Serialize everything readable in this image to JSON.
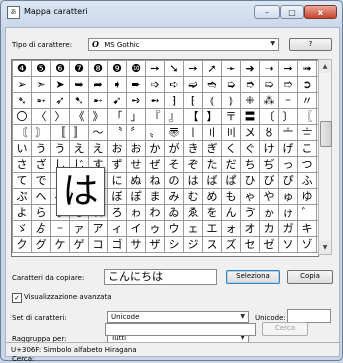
{
  "window": {
    "title": "Mappa caratteri",
    "minimize_symbol": "–",
    "maximize_symbol": "□",
    "close_symbol": "x"
  },
  "font_row": {
    "label": "Tipo di carattere:",
    "value": "MS Gothic",
    "font_glyph": "O",
    "help_label": "?"
  },
  "grid": {
    "rows": [
      [
        "❹",
        "❺",
        "❻",
        "❼",
        "❽",
        "❾",
        "❿",
        "➙",
        "➘",
        "➙",
        "➚",
        "➛",
        "➜",
        "➝",
        "➞",
        "➟",
        "➠"
      ],
      [
        "➢",
        "➣",
        "➤",
        "➥",
        "➦",
        "➧",
        "➨",
        "➩",
        "➪",
        "➫",
        "➬",
        "➭",
        "➮",
        "➯",
        "➱",
        "➲",
        "➳"
      ],
      [
        "➴",
        "➵",
        "➶",
        "➷",
        "➸",
        "➹",
        "➺",
        "➻",
        "⁆",
        "⁅",
        "⦅",
        "⦆",
        "⁜",
        "⁂",
        "゠",
        "〃",
        "〄"
      ],
      [
        "〇",
        "〈",
        "〉",
        "《",
        "》",
        "「",
        "」",
        "『",
        "』",
        "【",
        "】",
        "〒",
        "〓",
        "〔",
        "〕",
        "〖",
        "〗"
      ],
      [
        "〘",
        "〙",
        "〚",
        "〛",
        "〜",
        "〝",
        "〞",
        "〟",
        "〠",
        "〡",
        "〢",
        "〣",
        "〤",
        "〥",
        "〦",
        "〧",
        "〨"
      ],
      [
        "い",
        "う",
        "う",
        "え",
        "え",
        "お",
        "お",
        "か",
        "が",
        "き",
        "ぎ",
        "く",
        "ぐ",
        "け",
        "げ",
        "こ",
        "ご"
      ],
      [
        "さ",
        "ざ",
        "し",
        "じ",
        "す",
        "ず",
        "せ",
        "ぜ",
        "そ",
        "ぞ",
        "た",
        "だ",
        "ち",
        "ぢ",
        "っ",
        "つ",
        "づ"
      ],
      [
        "て",
        "で",
        "と",
        "ど",
        "な",
        "に",
        "ぬ",
        "ね",
        "の",
        "は",
        "ば",
        "ぱ",
        "ひ",
        "び",
        "ぴ",
        "ふ",
        "ぶ"
      ],
      [
        "ぷ",
        "へ",
        "べ",
        "ぺ",
        "ほ",
        "ぼ",
        "ぽ",
        "ま",
        "み",
        "む",
        "め",
        "も",
        "ゃ",
        "や",
        "ゅ",
        "ゆ",
        "ょ"
      ],
      [
        "よ",
        "ら",
        "り",
        "る",
        "れ",
        "ろ",
        "ゎ",
        "わ",
        "ゐ",
        "ゑ",
        "を",
        "ん",
        "ゔ",
        "ゕ",
        "ゖ",
        "゛",
        "゜"
      ],
      [
        "ゞ",
        "ゟ",
        "゠",
        "ァ",
        "ア",
        "ィ",
        "イ",
        "ゥ",
        "ウ",
        "ェ",
        "エ",
        "ォ",
        "オ",
        "カ",
        "ガ",
        "キ",
        "ギ"
      ],
      [
        "ク",
        "グ",
        "ケ",
        "ゲ",
        "コ",
        "ゴ",
        "サ",
        "ザ",
        "シ",
        "ジ",
        "ス",
        "ズ",
        "セ",
        "ゼ",
        "ソ",
        "ゾ",
        "タ"
      ]
    ],
    "magnified_char": "は"
  },
  "copy_row": {
    "label": "Caratteri da copiare:",
    "value": "こんにちは",
    "select_button": "Seleziona",
    "copy_button": "Copia"
  },
  "advanced": {
    "checkbox_label": "Visualizzazione avanzata",
    "checked_symbol": "✓",
    "charset_label": "Set di caratteri:",
    "charset_value": "Unicode",
    "unicode_label": "Unicode:",
    "unicode_value": "",
    "group_label": "Raggruppa per:",
    "group_value": "Tutti",
    "search_label": "Cerca:",
    "search_value": "",
    "search_button": "Cerca"
  },
  "status": {
    "text": "U+306F: Simbolo alfabeto Hiragana"
  },
  "icons": {
    "dropdown_arrow": "▼",
    "scroll_up": "▲",
    "scroll_down": "▼"
  }
}
